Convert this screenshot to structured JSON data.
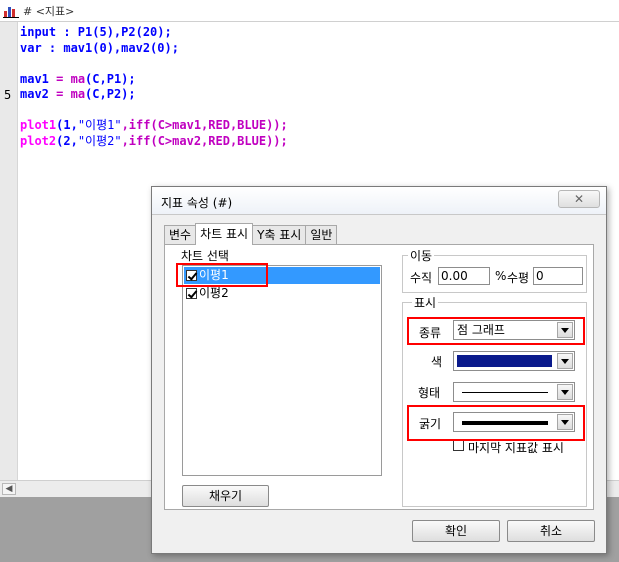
{
  "window": {
    "title": "# <지표>"
  },
  "editor": {
    "line_numbers": [
      {
        "label": "5"
      }
    ],
    "code": {
      "l1": {
        "kw": "input",
        "rest": " : P1(5),P2(20);"
      },
      "l2": {
        "kw": "var",
        "rest": " : mav1(0),mav2(0);"
      },
      "l4": {
        "a": "mav1",
        "b": " = ",
        "f": "ma",
        "c": "(C,P1);"
      },
      "l5": {
        "a": "mav2",
        "b": " = ",
        "f": "ma",
        "c": "(C,P2);"
      },
      "l7": {
        "p": "plot1",
        "n": "(1,",
        "s": "\"이평1\"",
        "m": ",iff(C>mav1,RED,BLUE));"
      },
      "l8": {
        "p": "plot2",
        "n": "(2,",
        "s": "\"이평2\"",
        "m": ",iff(C>mav2,RED,BLUE));"
      }
    }
  },
  "dialog": {
    "title": "지표 속성 (#)",
    "close_label": "✕",
    "tabs": [
      {
        "label": "변수"
      },
      {
        "label": "차트 표시"
      },
      {
        "label": "Y축 표시"
      },
      {
        "label": "일반"
      }
    ],
    "chart_select": {
      "label": "차트 선택",
      "items": [
        {
          "label": "이평1",
          "checked": true,
          "selected": true
        },
        {
          "label": "이평2",
          "checked": true,
          "selected": false
        }
      ],
      "fill_button": "채우기"
    },
    "move": {
      "label": "이동",
      "vertical_label": "수직",
      "vertical_value": "0.00",
      "percent": "%",
      "horizontal_label": "수평",
      "horizontal_value": "0"
    },
    "display": {
      "label": "표시",
      "type_label": "종류",
      "type_value": "점 그래프",
      "color_label": "색",
      "color_value": "#0a1a8c",
      "shape_label": "형태",
      "thickness_label": "굵기",
      "last_value_label": "마지막 지표값 표시"
    },
    "ok_button": "확인",
    "cancel_button": "취소"
  }
}
